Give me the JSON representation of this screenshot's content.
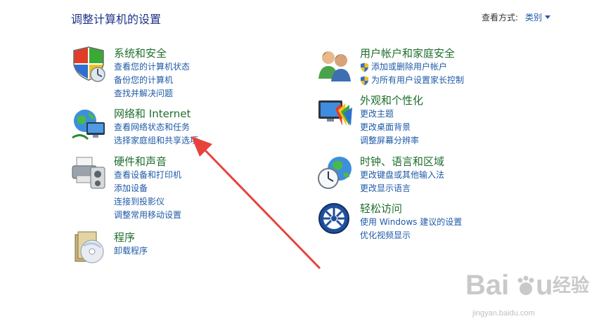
{
  "header": {
    "title": "调整计算机的设置",
    "view_label": "查看方式:",
    "view_value": "类别"
  },
  "categories": [
    {
      "title": "系统和安全",
      "icon": "shield-icon",
      "links": [
        "查看您的计算机状态",
        "备份您的计算机",
        "查找并解决问题"
      ]
    },
    {
      "title": "网络和 Internet",
      "icon": "network-globe-icon",
      "links": [
        "查看网络状态和任务",
        "选择家庭组和共享选项"
      ]
    },
    {
      "title": "硬件和声音",
      "icon": "printer-speaker-icon",
      "links": [
        "查看设备和打印机",
        "添加设备",
        "连接到投影仪",
        "调整常用移动设置"
      ]
    },
    {
      "title": "程序",
      "icon": "programs-disc-icon",
      "links": [
        "卸载程序"
      ]
    },
    {
      "title": "用户帐户和家庭安全",
      "icon": "users-icon",
      "links": [
        "添加或删除用户帐户",
        "为所有用户设置家长控制"
      ]
    },
    {
      "title": "外观和个性化",
      "icon": "monitor-palette-icon",
      "links": [
        "更改主题",
        "更改桌面背景",
        "调整屏幕分辨率"
      ]
    },
    {
      "title": "时钟、语言和区域",
      "icon": "clock-globe-icon",
      "links": [
        "更改键盘或其他输入法",
        "更改显示语言"
      ]
    },
    {
      "title": "轻松访问",
      "icon": "ease-of-access-icon",
      "links": [
        "使用 Windows 建议的设置",
        "优化视频显示"
      ]
    }
  ],
  "watermark": {
    "brand": "Bai",
    "brand_end": "u",
    "brand_cn": "经验",
    "url": "jingyan.baidu.com"
  },
  "colors": {
    "title": "#1e3287",
    "category": "#1e6e2c",
    "link": "#1e5aa8",
    "arrow": "#e8423c"
  }
}
